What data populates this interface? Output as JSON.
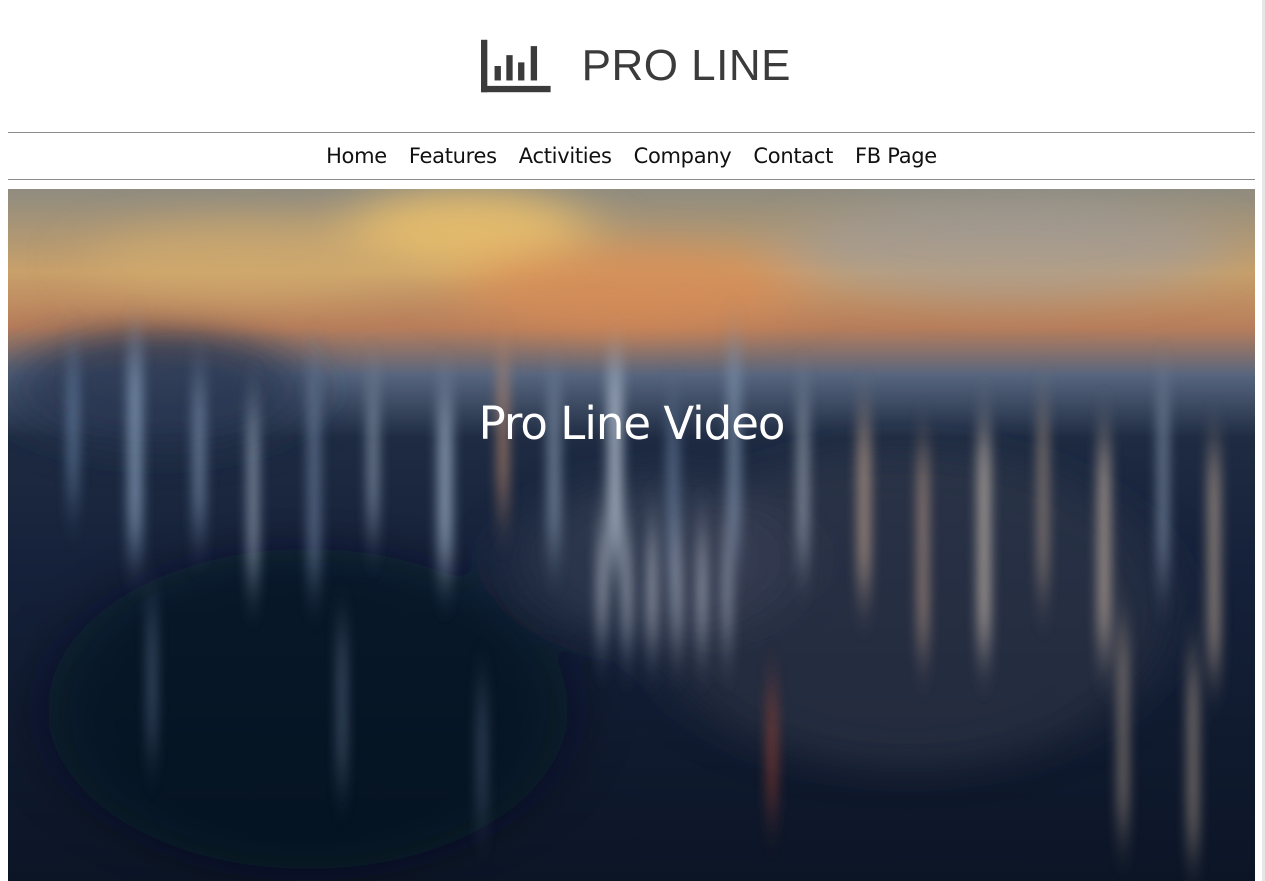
{
  "brand": {
    "name": "PRO LINE",
    "logo_icon": "bar-chart-icon",
    "color": "#3b3b3b"
  },
  "nav": {
    "items": [
      {
        "label": "Home"
      },
      {
        "label": "Features"
      },
      {
        "label": "Activities"
      },
      {
        "label": "Company"
      },
      {
        "label": "Contact"
      },
      {
        "label": "FB Page"
      }
    ]
  },
  "hero": {
    "title": "Pro Line Video",
    "background": "blurred-city-skyline-at-dusk"
  },
  "colors": {
    "divider": "#8c8c8c",
    "hero_text": "#ffffff",
    "hero_dark": "#101a2b",
    "sunset_orange": "#d08a55",
    "sky_gold": "#e6b86a"
  }
}
